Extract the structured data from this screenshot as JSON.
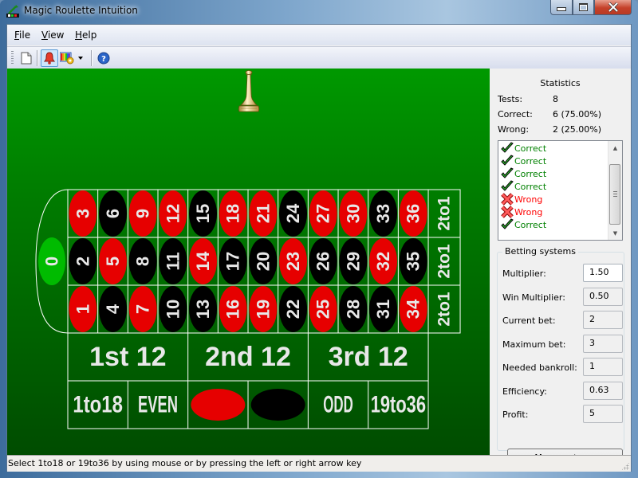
{
  "window": {
    "title": "Magic Roulette Intuition",
    "controls": {
      "minimize": "minimize",
      "maximize": "maximize",
      "close": "close"
    }
  },
  "menu": {
    "items": [
      {
        "label": "File",
        "accel": "F",
        "rest": "ile"
      },
      {
        "label": "View",
        "accel": "V",
        "rest": "iew"
      },
      {
        "label": "Help",
        "accel": "H",
        "rest": "elp"
      }
    ]
  },
  "toolbar": {
    "buttons": [
      {
        "icon": "new-document-icon",
        "active": false
      },
      {
        "icon": "bell-icon",
        "active": true
      },
      {
        "icon": "color-settings-icon",
        "active": false,
        "dropdown": true
      },
      {
        "icon": "help-icon",
        "active": false
      }
    ]
  },
  "table": {
    "zero": {
      "label": "0",
      "color": "#00bb00"
    },
    "rows": [
      [
        {
          "n": "3",
          "c": "red"
        },
        {
          "n": "6",
          "c": "black"
        },
        {
          "n": "9",
          "c": "red"
        },
        {
          "n": "12",
          "c": "red"
        },
        {
          "n": "15",
          "c": "black"
        },
        {
          "n": "18",
          "c": "red"
        },
        {
          "n": "21",
          "c": "red"
        },
        {
          "n": "24",
          "c": "black"
        },
        {
          "n": "27",
          "c": "red"
        },
        {
          "n": "30",
          "c": "red"
        },
        {
          "n": "33",
          "c": "black"
        },
        {
          "n": "36",
          "c": "red"
        }
      ],
      [
        {
          "n": "2",
          "c": "black"
        },
        {
          "n": "5",
          "c": "red"
        },
        {
          "n": "8",
          "c": "black"
        },
        {
          "n": "11",
          "c": "black"
        },
        {
          "n": "14",
          "c": "red"
        },
        {
          "n": "17",
          "c": "black"
        },
        {
          "n": "20",
          "c": "black"
        },
        {
          "n": "23",
          "c": "red"
        },
        {
          "n": "26",
          "c": "black"
        },
        {
          "n": "29",
          "c": "black"
        },
        {
          "n": "32",
          "c": "red"
        },
        {
          "n": "35",
          "c": "black"
        }
      ],
      [
        {
          "n": "1",
          "c": "red"
        },
        {
          "n": "4",
          "c": "black"
        },
        {
          "n": "7",
          "c": "red"
        },
        {
          "n": "10",
          "c": "black"
        },
        {
          "n": "13",
          "c": "black"
        },
        {
          "n": "16",
          "c": "red"
        },
        {
          "n": "19",
          "c": "red"
        },
        {
          "n": "22",
          "c": "black"
        },
        {
          "n": "25",
          "c": "red"
        },
        {
          "n": "28",
          "c": "black"
        },
        {
          "n": "31",
          "c": "black"
        },
        {
          "n": "34",
          "c": "red"
        }
      ]
    ],
    "columns_label": [
      "2to1",
      "2to1",
      "2to1"
    ],
    "dozens": [
      "1st 12",
      "2nd 12",
      "3rd 12"
    ],
    "outside": [
      {
        "label": "1to18",
        "type": "text"
      },
      {
        "label": "EVEN",
        "type": "text"
      },
      {
        "label": "",
        "type": "red-oval",
        "name": "red"
      },
      {
        "label": "",
        "type": "black-oval",
        "name": "black"
      },
      {
        "label": "ODD",
        "type": "text"
      },
      {
        "label": "19to36",
        "type": "text"
      }
    ],
    "colors": {
      "red": "#e60000",
      "black": "#000000",
      "text": "#e8e8e8",
      "line": "#ffffff"
    }
  },
  "statistics": {
    "title": "Statistics",
    "tests_label": "Tests:",
    "tests_value": "8",
    "correct_label": "Correct:",
    "correct_value": "6 (75.00%)",
    "wrong_label": "Wrong:",
    "wrong_value": "2 (25.00%)",
    "results": [
      {
        "label": "Correct",
        "status": "correct"
      },
      {
        "label": "Correct",
        "status": "correct"
      },
      {
        "label": "Correct",
        "status": "correct"
      },
      {
        "label": "Correct",
        "status": "correct"
      },
      {
        "label": "Wrong",
        "status": "wrong"
      },
      {
        "label": "Wrong",
        "status": "wrong"
      },
      {
        "label": "Correct",
        "status": "correct"
      }
    ],
    "colors": {
      "correct": "#008000",
      "wrong": "#ff0000"
    }
  },
  "betting": {
    "title": "Betting systems",
    "fields": [
      {
        "label": "Multiplier:",
        "value": "1.50",
        "editable": true
      },
      {
        "label": "Win Multiplier:",
        "value": "0.50",
        "editable": false
      },
      {
        "label": "Current bet:",
        "value": "2",
        "editable": false
      },
      {
        "label": "Maximum bet:",
        "value": "3",
        "editable": false
      },
      {
        "label": "Needed bankroll:",
        "value": "1",
        "editable": false
      },
      {
        "label": "Efficiency:",
        "value": "0.63",
        "editable": false
      },
      {
        "label": "Profit:",
        "value": "5",
        "editable": false
      }
    ],
    "more_button": {
      "accel": "M",
      "rest": "ore systems",
      "label": "More systems"
    }
  },
  "statusbar": {
    "text": "Select 1to18 or 19to36 by using mouse or by pressing the left or right arrow key"
  }
}
